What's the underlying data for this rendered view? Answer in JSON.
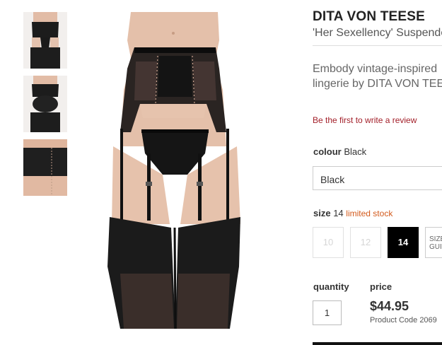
{
  "product": {
    "brand": "DITA VON TEESE",
    "name": "'Her Sexellency' Suspender",
    "description": "Embody vintage-inspired\nlingerie by DITA VON TEESE",
    "review_link": "Be the first to write a review"
  },
  "colour": {
    "label": "colour",
    "value": "Black",
    "selected_option": "Black"
  },
  "size": {
    "label": "size",
    "value": "14",
    "stock": "limited stock",
    "options": [
      {
        "label": "10",
        "available": false
      },
      {
        "label": "12",
        "available": false
      },
      {
        "label": "14",
        "available": true,
        "selected": true
      }
    ],
    "guide_label": "SIZE GUIDE"
  },
  "purchase": {
    "quantity_label": "quantity",
    "quantity": "1",
    "price_label": "price",
    "price": "$44.95",
    "product_code": "Product Code 2069"
  },
  "gallery": {
    "thumbnails": [
      "front view",
      "back view",
      "detail view"
    ]
  },
  "colors": {
    "accent_review": "#a3202a",
    "stock_orange": "#d35a1c",
    "selected_size_bg": "#000000"
  }
}
